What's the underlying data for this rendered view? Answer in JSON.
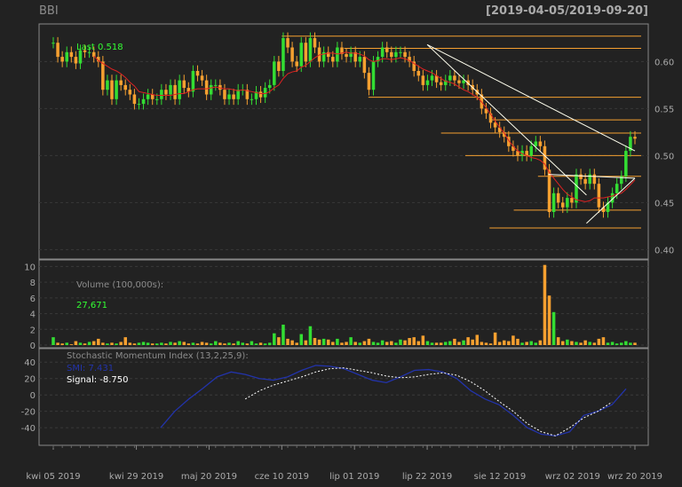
{
  "header": {
    "symbol": "BBI",
    "date_range": "[2019-04-05/2019-09-20]"
  },
  "colors": {
    "up": "#33dd33",
    "down": "#f5a030",
    "ma": "#dd2222",
    "level": "#f5a030",
    "trend": "#ffffee",
    "smi": "#2233aa",
    "signal": "#ffffff",
    "label": "#33ff33"
  },
  "price_panel": {
    "last_label": "Last 0.518",
    "yticks": [
      "0.60",
      "0.55",
      "0.50",
      "0.45",
      "0.40"
    ]
  },
  "volume_panel": {
    "title": "Volume (100,000s):",
    "value": "27,671",
    "yticks": [
      "10",
      "8",
      "6",
      "4",
      "2",
      "0"
    ]
  },
  "smi_panel": {
    "title": "Stochastic Momentum Index (13,2,25,9):",
    "smi_label": "SMI: 7.431",
    "signal_label": "Signal: -8.750",
    "yticks": [
      "40",
      "20",
      "0",
      "-20",
      "-40"
    ]
  },
  "xaxis": {
    "labels": [
      "kwi 05 2019",
      "kwi 29 2019",
      "maj 20 2019",
      "cze 10 2019",
      "lip 01 2019",
      "lip 22 2019",
      "sie 12 2019",
      "wrz 02 2019",
      "wrz 20 2019"
    ]
  },
  "chart_data": {
    "type": "candlestick",
    "x_range": [
      "2019-04-05",
      "2019-09-20"
    ],
    "x_ticks": [
      "2019-04-05",
      "2019-04-29",
      "2019-05-20",
      "2019-06-10",
      "2019-07-01",
      "2019-07-22",
      "2019-08-12",
      "2019-09-02",
      "2019-09-20"
    ],
    "price_ylim": [
      0.39,
      0.64
    ],
    "volume_ylim": [
      0,
      10.5
    ],
    "smi_ylim": [
      -55,
      50
    ],
    "close": [
      0.62,
      0.605,
      0.6,
      0.61,
      0.605,
      0.598,
      0.612,
      0.61,
      0.61,
      0.605,
      0.6,
      0.57,
      0.58,
      0.56,
      0.58,
      0.575,
      0.57,
      0.565,
      0.555,
      0.555,
      0.56,
      0.565,
      0.56,
      0.56,
      0.57,
      0.565,
      0.575,
      0.56,
      0.58,
      0.572,
      0.568,
      0.59,
      0.585,
      0.58,
      0.565,
      0.575,
      0.575,
      0.57,
      0.56,
      0.565,
      0.56,
      0.57,
      0.57,
      0.56,
      0.56,
      0.568,
      0.562,
      0.572,
      0.575,
      0.6,
      0.59,
      0.625,
      0.615,
      0.6,
      0.595,
      0.62,
      0.6,
      0.625,
      0.615,
      0.6,
      0.61,
      0.605,
      0.6,
      0.615,
      0.608,
      0.605,
      0.61,
      0.6,
      0.605,
      0.588,
      0.57,
      0.6,
      0.605,
      0.615,
      0.61,
      0.605,
      0.61,
      0.61,
      0.605,
      0.6,
      0.59,
      0.585,
      0.575,
      0.58,
      0.585,
      0.578,
      0.575,
      0.58,
      0.585,
      0.58,
      0.577,
      0.58,
      0.575,
      0.57,
      0.565,
      0.55,
      0.545,
      0.535,
      0.53,
      0.525,
      0.52,
      0.51,
      0.505,
      0.5,
      0.505,
      0.5,
      0.51,
      0.515,
      0.51,
      0.485,
      0.44,
      0.46,
      0.45,
      0.445,
      0.455,
      0.45,
      0.48,
      0.475,
      0.47,
      0.48,
      0.47,
      0.445,
      0.44,
      0.45,
      0.46,
      0.47,
      0.478,
      0.505,
      0.52,
      0.518
    ],
    "ma": [
      null,
      null,
      null,
      null,
      null,
      null,
      null,
      null,
      null,
      0.606,
      0.601,
      0.598,
      0.595,
      0.592,
      0.59,
      0.587,
      0.583,
      0.578,
      0.574,
      0.568,
      0.567,
      0.566,
      0.565,
      0.564,
      0.564,
      0.564,
      0.564,
      0.565,
      0.566,
      0.566,
      0.568,
      0.57,
      0.571,
      0.571,
      0.571,
      0.572,
      0.573,
      0.572,
      0.571,
      0.571,
      0.57,
      0.569,
      0.57,
      0.569,
      0.568,
      0.567,
      0.566,
      0.566,
      0.568,
      0.572,
      0.575,
      0.582,
      0.587,
      0.589,
      0.59,
      0.594,
      0.596,
      0.6,
      0.604,
      0.607,
      0.608,
      0.609,
      0.609,
      0.608,
      0.609,
      0.61,
      0.609,
      0.609,
      0.608,
      0.606,
      0.602,
      0.6,
      0.601,
      0.603,
      0.603,
      0.602,
      0.603,
      0.604,
      0.603,
      0.601,
      0.598,
      0.595,
      0.592,
      0.59,
      0.588,
      0.585,
      0.582,
      0.579,
      0.578,
      0.576,
      0.573,
      0.57,
      0.568,
      0.565,
      0.562,
      0.557,
      0.551,
      0.544,
      0.537,
      0.53,
      0.524,
      0.516,
      0.51,
      0.505,
      0.502,
      0.5,
      0.498,
      0.497,
      0.495,
      0.491,
      0.482,
      0.476,
      0.47,
      0.464,
      0.459,
      0.456,
      0.453,
      0.452,
      0.451,
      0.452,
      0.455,
      0.455,
      0.455,
      0.456,
      0.457,
      0.459,
      0.46,
      0.464,
      0.469,
      0.474
    ],
    "volume": [
      1.0,
      0.3,
      0.2,
      0.3,
      0.1,
      0.5,
      0.3,
      0.2,
      0.4,
      0.5,
      0.8,
      0.3,
      0.2,
      0.3,
      0.2,
      0.4,
      1.0,
      0.3,
      0.2,
      0.3,
      0.4,
      0.3,
      0.2,
      0.2,
      0.3,
      0.2,
      0.4,
      0.3,
      0.5,
      0.4,
      0.2,
      0.3,
      0.2,
      0.4,
      0.3,
      0.2,
      0.5,
      0.3,
      0.2,
      0.3,
      0.2,
      0.5,
      0.3,
      0.2,
      0.5,
      0.2,
      0.3,
      0.2,
      0.3,
      1.5,
      1.0,
      2.6,
      0.8,
      0.6,
      0.3,
      1.4,
      0.6,
      2.4,
      0.9,
      0.7,
      0.8,
      0.7,
      0.4,
      0.8,
      0.3,
      0.4,
      1.0,
      0.4,
      0.3,
      0.5,
      0.8,
      0.4,
      0.3,
      0.6,
      0.4,
      0.5,
      0.3,
      0.7,
      0.6,
      0.9,
      1.0,
      0.5,
      1.2,
      0.5,
      0.3,
      0.3,
      0.3,
      0.4,
      0.5,
      0.8,
      0.4,
      0.6,
      1.0,
      0.7,
      1.3,
      0.4,
      0.3,
      0.2,
      1.6,
      0.4,
      0.6,
      0.5,
      1.2,
      0.8,
      0.3,
      0.4,
      0.5,
      0.3,
      0.6,
      10.2,
      6.3,
      4.2,
      1.0,
      0.5,
      0.7,
      0.5,
      0.4,
      0.3,
      0.6,
      0.4,
      0.3,
      0.8,
      1.0,
      0.3,
      0.4,
      0.2,
      0.3,
      0.5,
      0.3,
      0.3
    ],
    "smi": {
      "dates": [
        "2019-05-06",
        "2019-05-10",
        "2019-05-15",
        "2019-05-20",
        "2019-05-24",
        "2019-05-29",
        "2019-06-03",
        "2019-06-07",
        "2019-06-12",
        "2019-06-17",
        "2019-06-21",
        "2019-06-26",
        "2019-07-01",
        "2019-07-05",
        "2019-07-10",
        "2019-07-15",
        "2019-07-19",
        "2019-07-24",
        "2019-07-29",
        "2019-08-02",
        "2019-08-07",
        "2019-08-12",
        "2019-08-16",
        "2019-08-21",
        "2019-08-26",
        "2019-08-30",
        "2019-09-04",
        "2019-09-09",
        "2019-09-13",
        "2019-09-17",
        "2019-09-20"
      ],
      "values": [
        -40,
        -20,
        -5,
        8,
        22,
        28,
        25,
        20,
        18,
        22,
        30,
        36,
        35,
        32,
        25,
        18,
        15,
        22,
        30,
        31,
        28,
        20,
        5,
        -5,
        -12,
        -25,
        -40,
        -48,
        -50,
        -45,
        -25,
        -20,
        -12,
        7.431
      ],
      "signal": [
        null,
        null,
        null,
        null,
        null,
        null,
        -5,
        5,
        12,
        17,
        22,
        28,
        32,
        33,
        30,
        27,
        23,
        21,
        22,
        25,
        27,
        24,
        16,
        5,
        -8,
        -20,
        -35,
        -45,
        -50,
        -40,
        -28,
        -20,
        -8.75
      ]
    },
    "levels": [
      0.627,
      0.614,
      0.562,
      0.538,
      0.524,
      0.5,
      0.478,
      0.442,
      0.423
    ],
    "trendlines": [
      {
        "from": [
          "2019-07-22",
          0.618
        ],
        "to": [
          "2019-09-20",
          0.505
        ]
      },
      {
        "from": [
          "2019-07-22",
          0.618
        ],
        "to": [
          "2019-09-06",
          0.458
        ]
      },
      {
        "from": [
          "2019-08-26",
          0.48
        ],
        "to": [
          "2019-09-20",
          0.476
        ]
      },
      {
        "from": [
          "2019-09-06",
          0.428
        ],
        "to": [
          "2019-09-20",
          0.476
        ]
      }
    ]
  }
}
